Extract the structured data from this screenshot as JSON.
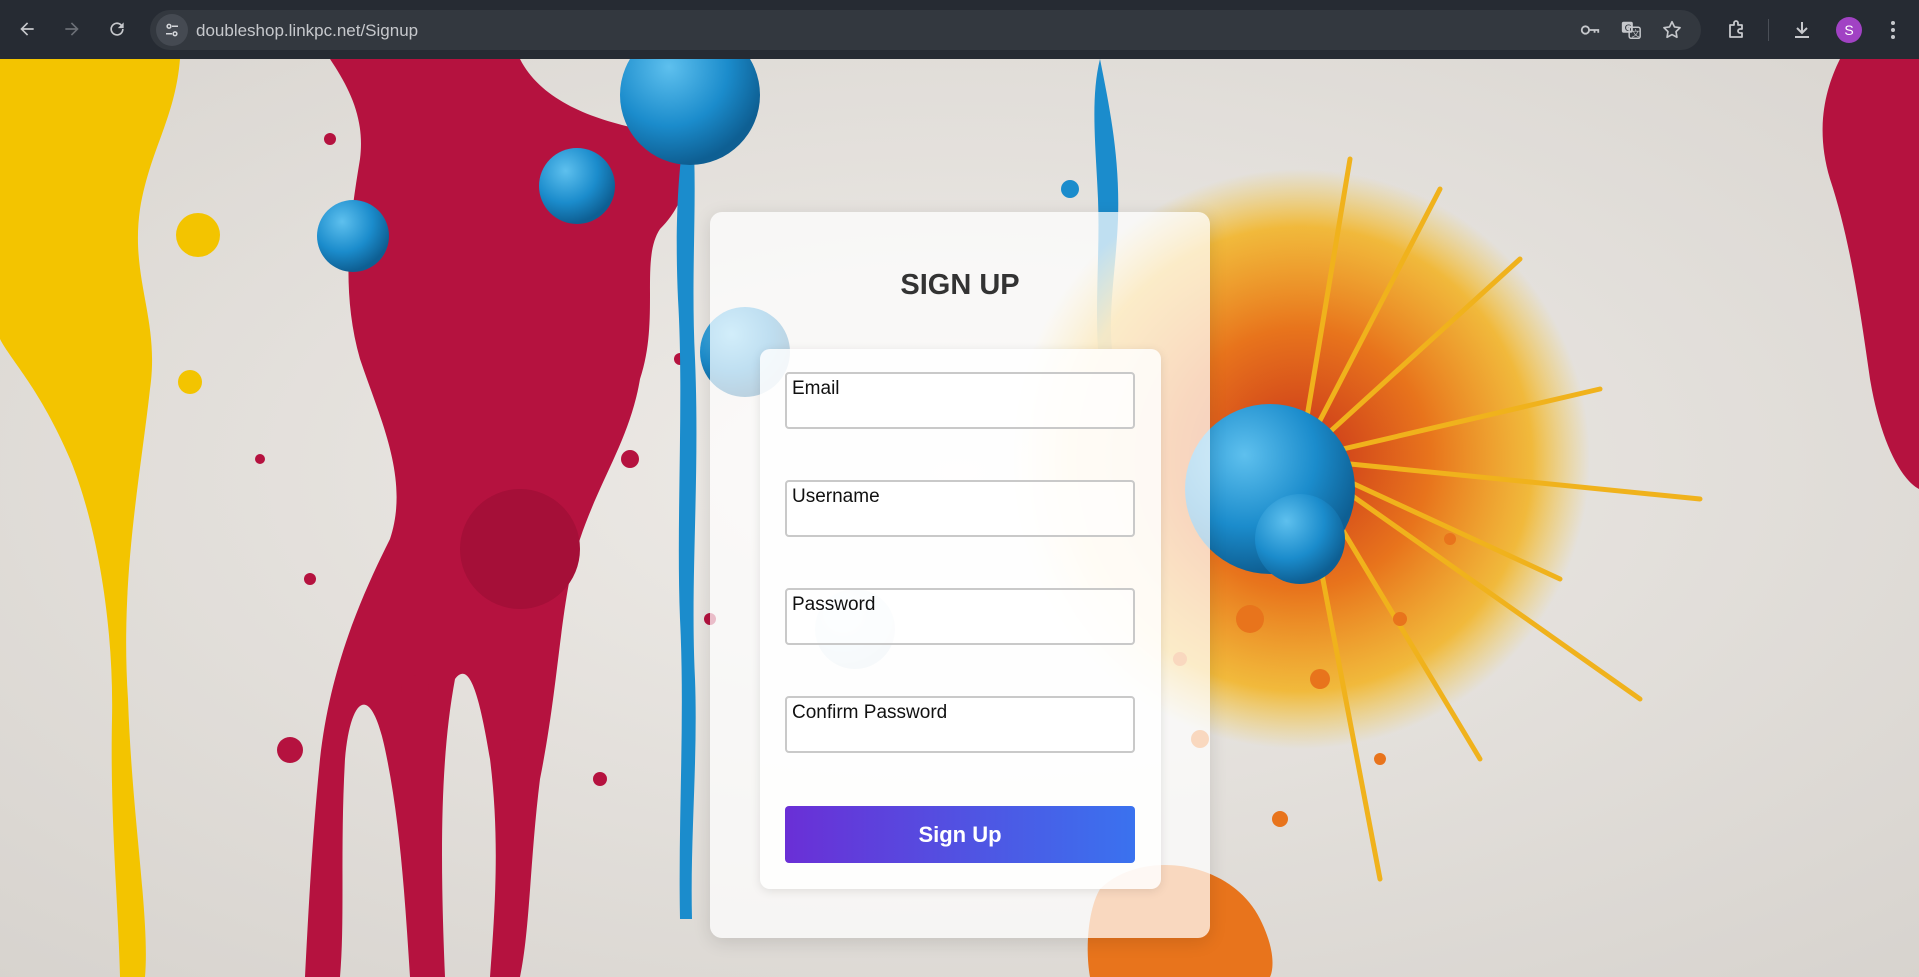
{
  "browser": {
    "url": "doubleshop.linkpc.net/Signup",
    "avatar_letter": "S",
    "icons": {
      "back": "arrow-left-icon",
      "forward": "arrow-right-icon",
      "reload": "reload-icon",
      "site_info": "tune-icon",
      "password": "key-icon",
      "translate": "translate-icon",
      "bookmark": "star-icon",
      "extensions": "puzzle-icon",
      "downloads": "download-icon",
      "menu": "kebab-menu-icon"
    }
  },
  "signup": {
    "title": "SIGN UP",
    "fields": [
      {
        "label": "Email",
        "value": ""
      },
      {
        "label": "Username",
        "value": ""
      },
      {
        "label": "Password",
        "value": ""
      },
      {
        "label": "Confirm Password",
        "value": ""
      }
    ],
    "submit_label": "Sign Up",
    "button_gradient": [
      "#6a2fd6",
      "#3a72ef"
    ]
  },
  "background": {
    "description_colors": [
      "#f2c400",
      "#b5123f",
      "#1e8fcf",
      "#e46a1a"
    ]
  }
}
